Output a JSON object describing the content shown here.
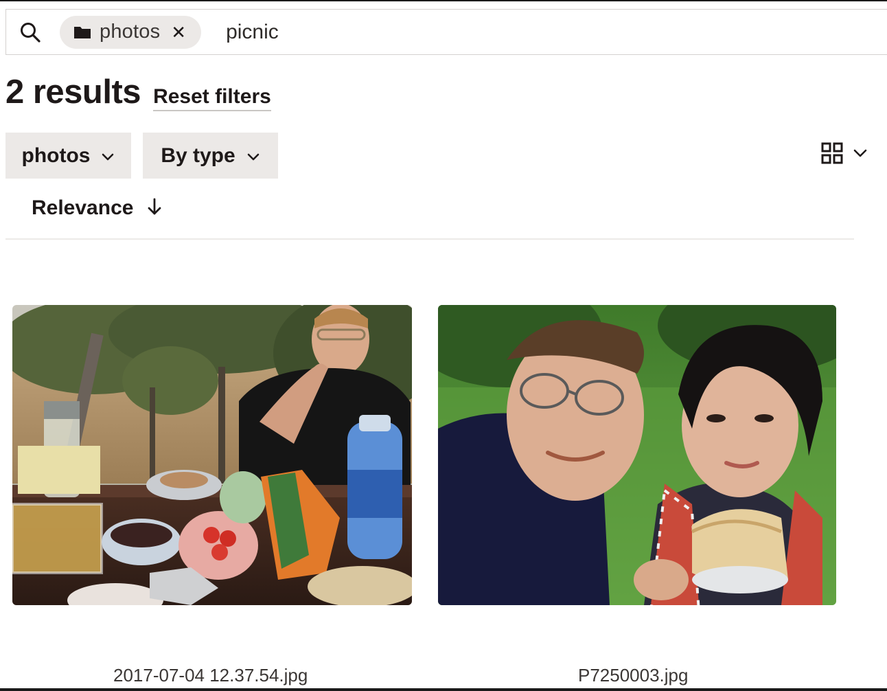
{
  "search": {
    "icon": "search-icon",
    "filter_chip": {
      "icon": "folder-icon",
      "label": "photos",
      "close_icon": "close-icon",
      "close_glyph": "✕"
    },
    "query": "picnic"
  },
  "results": {
    "count_label": "2 results",
    "reset_label": "Reset filters"
  },
  "filters": [
    {
      "label": "photos",
      "icon": "chevron-down-icon"
    },
    {
      "label": "By type",
      "icon": "chevron-down-icon"
    }
  ],
  "view_toggle": {
    "icon": "grid-view-icon",
    "dropdown_icon": "chevron-down-icon"
  },
  "sort": {
    "label": "Relevance",
    "icon": "arrow-down-icon"
  },
  "items": [
    {
      "filename": "2017-07-04 12.37.54.jpg",
      "thumbnail": "picnic-table-photo"
    },
    {
      "filename": "P7250003.jpg",
      "thumbnail": "selfie-photo"
    }
  ],
  "colors": {
    "text": "#1e1919",
    "chip_background": "#ece9e7",
    "border": "#d4d1cf"
  }
}
